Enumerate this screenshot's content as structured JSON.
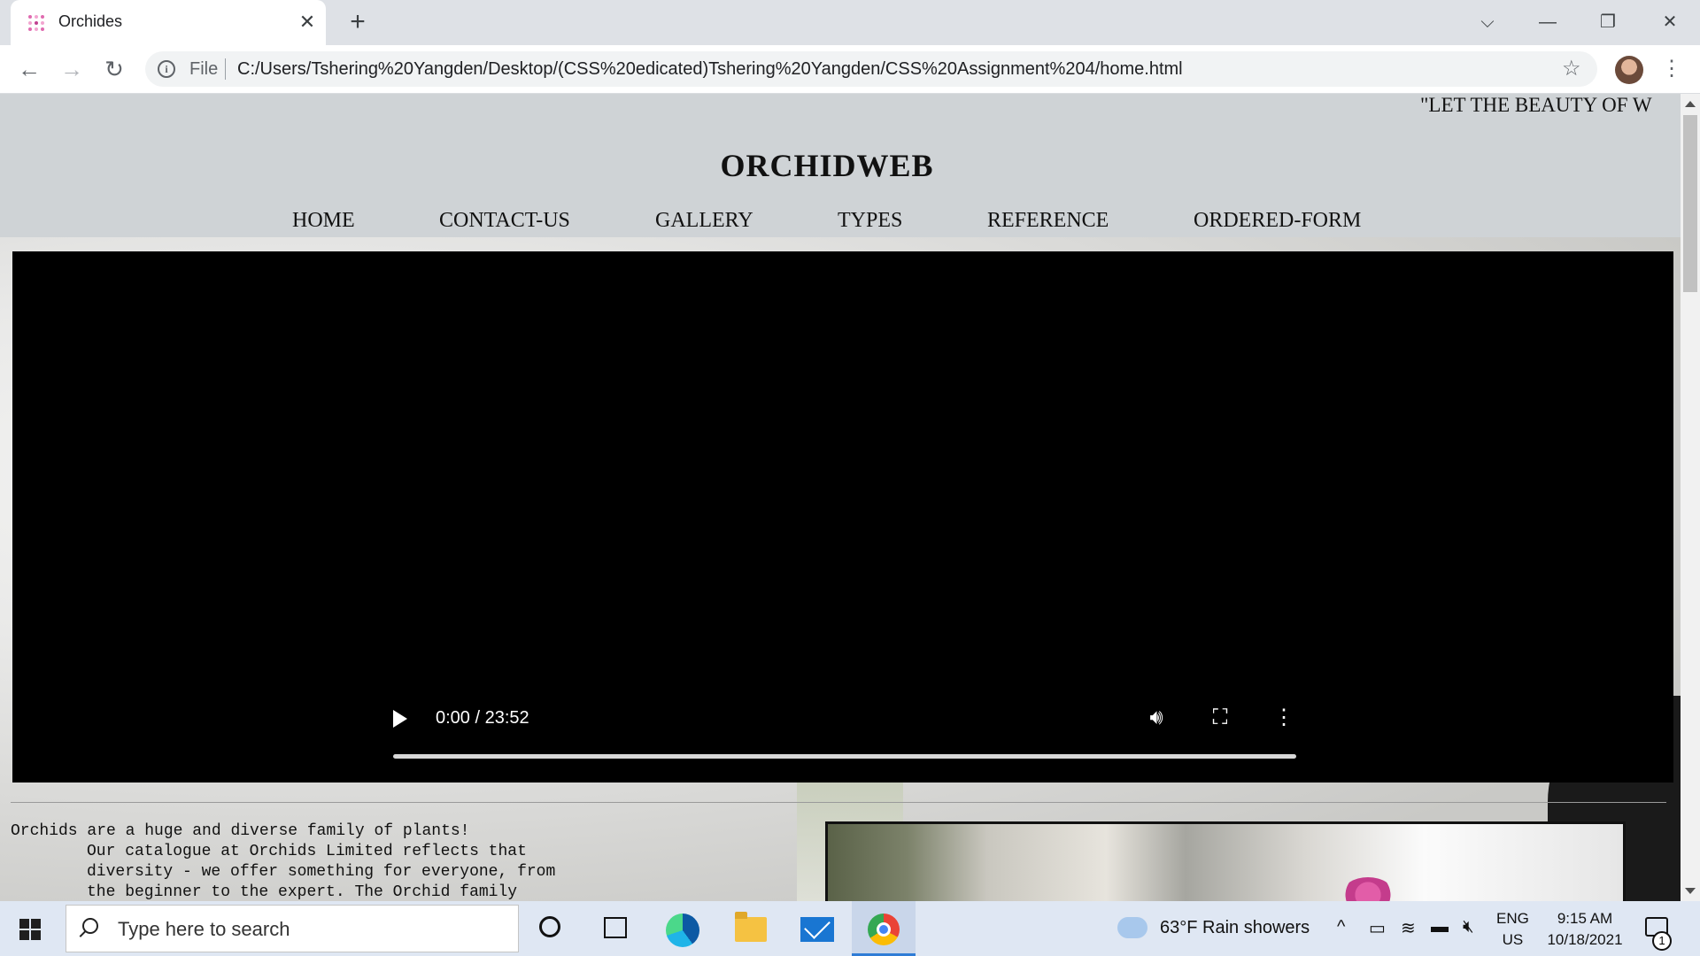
{
  "browser": {
    "tab_title": "Orchides",
    "tab_close": "✕",
    "new_tab": "+",
    "address_prefix": "File",
    "url": "C:/Users/Tshering%20Yangden/Desktop/(CSS%20edicated)Tshering%20Yangden/CSS%20Assignment%204/home.html",
    "icons": [
      "back-icon",
      "forward-icon",
      "reload-icon",
      "info-icon",
      "star-icon",
      "profile-icon",
      "menu-icon",
      "tab-search-icon",
      "minimize-icon",
      "restore-icon",
      "close-icon"
    ]
  },
  "page": {
    "marquee": "\"LET THE BEAUTY OF W",
    "site_title": "ORCHIDWEB",
    "nav": [
      "HOME",
      "CONTACT-US",
      "GALLERY",
      "TYPES",
      "REFERENCE",
      "ORDERED-FORM"
    ],
    "video": {
      "time": "0:00 / 23:52",
      "progress": 0
    },
    "intro_lines": [
      "Orchids are a huge and diverse family of plants!",
      "Our catalogue at Orchids Limited reflects that",
      "diversity - we offer something for everyone, from",
      "the beginner to the expert. The Orchid family"
    ]
  },
  "taskbar": {
    "search_placeholder": "Type here to search",
    "weather": "63°F  Rain showers",
    "lang_top": "ENG",
    "lang_bottom": "US",
    "time": "9:15 AM",
    "date": "10/18/2021",
    "notification_count": "1"
  }
}
